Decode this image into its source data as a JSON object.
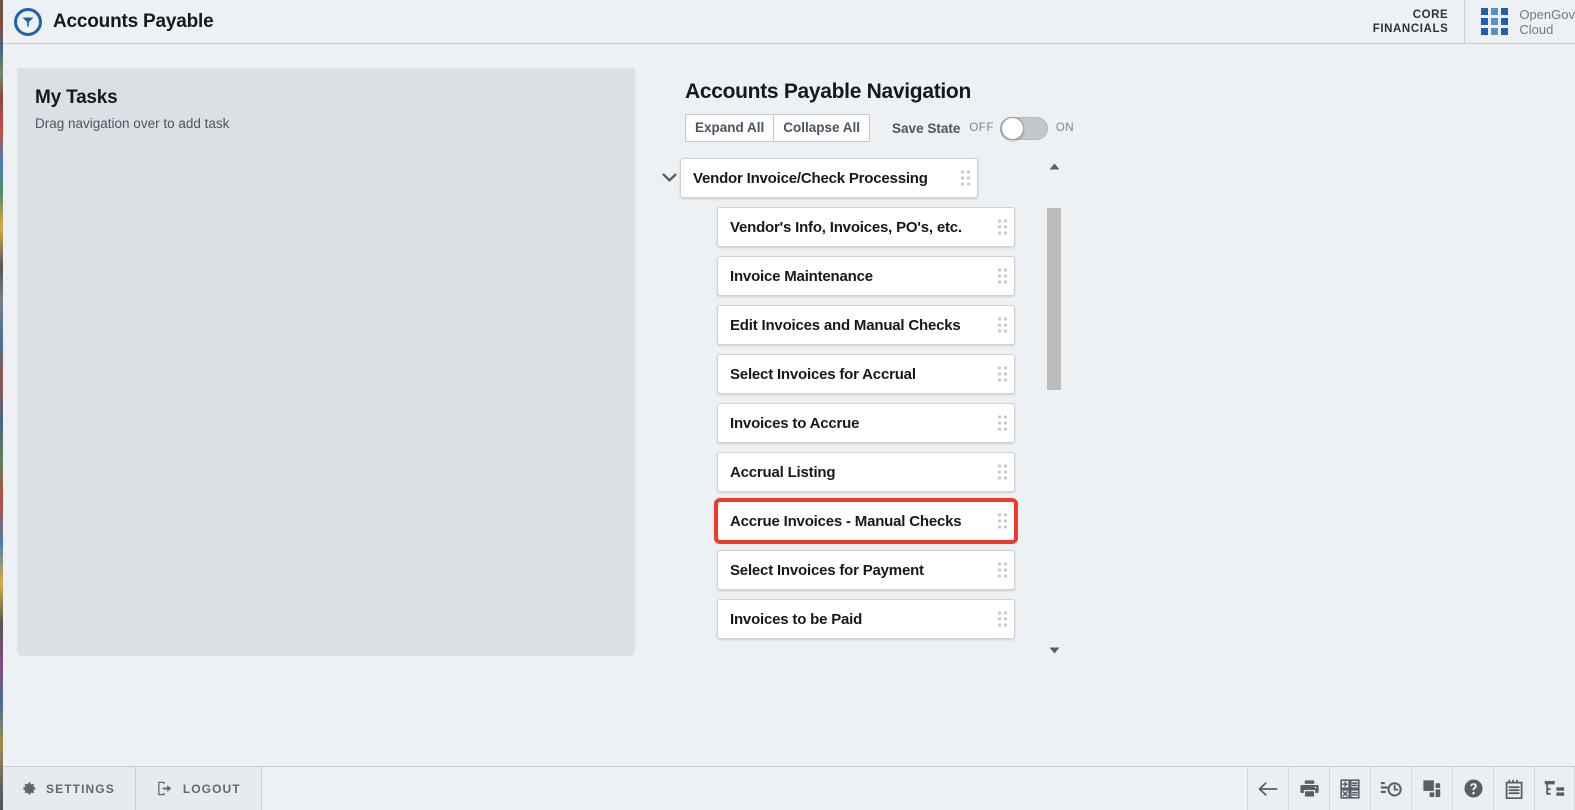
{
  "header": {
    "logo_icon": "opengov-arrow-logo-icon",
    "app_title": "Accounts Payable",
    "suite_line1": "CORE",
    "suite_line2": "FINANCIALS",
    "grid_icon": "app-grid-icon",
    "product_line1": "OpenGov",
    "product_line2": "Cloud"
  },
  "tasks_panel": {
    "title": "My Tasks",
    "empty_hint": "Drag navigation over to add task"
  },
  "navigation": {
    "title": "Accounts Payable Navigation",
    "expand_all_label": "Expand All",
    "collapse_all_label": "Collapse All",
    "save_state_label": "Save State",
    "toggle_off_label": "OFF",
    "toggle_on_label": "ON",
    "save_state_value": "OFF",
    "parent": {
      "label": "Vendor Invoice/Check Processing",
      "expanded": true,
      "chevron_icon": "chevron-down-icon",
      "grip_icon": "drag-handle-icon"
    },
    "children": [
      {
        "label": "Vendor's Info, Invoices, PO's, etc.",
        "highlighted": false
      },
      {
        "label": "Invoice Maintenance",
        "highlighted": false
      },
      {
        "label": "Edit Invoices and Manual Checks",
        "highlighted": false
      },
      {
        "label": "Select Invoices for Accrual",
        "highlighted": false
      },
      {
        "label": "Invoices to Accrue",
        "highlighted": false
      },
      {
        "label": "Accrual Listing",
        "highlighted": false
      },
      {
        "label": "Accrue Invoices - Manual Checks",
        "highlighted": true
      },
      {
        "label": "Select Invoices for Payment",
        "highlighted": false
      },
      {
        "label": "Invoices to be Paid",
        "highlighted": false
      }
    ],
    "highlight_color": "#f0392b",
    "scrollbar": {
      "up_icon": "scroll-up-arrow-icon",
      "down_icon": "scroll-down-arrow-icon",
      "thumb_icon": "scrollbar-thumb"
    }
  },
  "footer": {
    "settings_label": "SETTINGS",
    "settings_icon": "gear-icon",
    "logout_label": "LOGOUT",
    "logout_icon": "logout-icon",
    "toolbar_icons": [
      "back-arrow-icon",
      "print-icon",
      "calculator-icon",
      "schedule-clock-icon",
      "windows-stack-icon",
      "help-icon",
      "notepad-icon",
      "tree-view-icon"
    ]
  },
  "colors": {
    "brand_blue": "#1f62ad",
    "page_bg": "#eef1f4",
    "panel_bg": "#dcdfe3",
    "highlight_red": "#f0392b"
  }
}
